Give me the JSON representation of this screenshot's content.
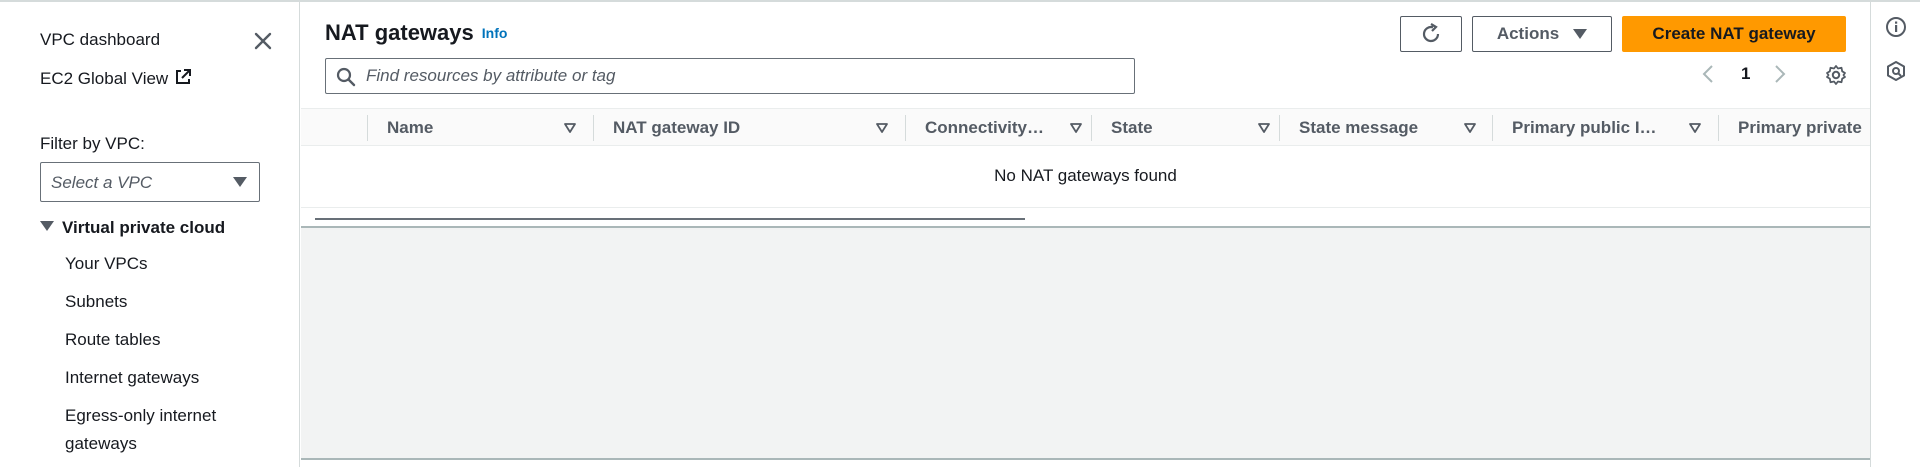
{
  "sidebar": {
    "dashboard_link": "VPC dashboard",
    "global_view_link": "EC2 Global View",
    "filter_label": "Filter by VPC:",
    "vpc_select_placeholder": "Select a VPC",
    "section_title": "Virtual private cloud",
    "items": [
      {
        "label": "Your VPCs"
      },
      {
        "label": "Subnets"
      },
      {
        "label": "Route tables"
      },
      {
        "label": "Internet gateways"
      },
      {
        "label": "Egress-only internet gateways"
      }
    ]
  },
  "header": {
    "title": "NAT gateways",
    "info_link": "Info",
    "actions_label": "Actions",
    "create_label": "Create NAT gateway"
  },
  "search": {
    "placeholder": "Find resources by attribute or tag"
  },
  "pagination": {
    "current_page": "1"
  },
  "table": {
    "columns": [
      "Name",
      "NAT gateway ID",
      "Connectivity…",
      "State",
      "State message",
      "Primary public I…",
      "Primary private"
    ],
    "empty_message": "No NAT gateways found"
  },
  "colors": {
    "primary_button": "#ff9900",
    "link": "#0073bb",
    "text": "#16191f",
    "muted": "#545b64"
  },
  "icons": {
    "close": "close-icon",
    "external": "external-link-icon",
    "refresh": "refresh-icon",
    "search": "search-icon",
    "settings": "gear-icon",
    "info": "info-circle-icon",
    "rail_secondary": "hexagon-icon"
  }
}
